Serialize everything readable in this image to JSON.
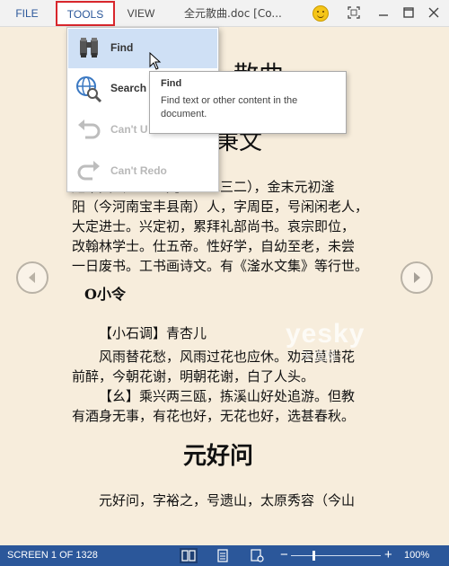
{
  "menu": {
    "file": "FILE",
    "tools": "TOOLS",
    "view": "VIEW",
    "doc_title": "全元散曲.doc [Co..."
  },
  "window_controls": [
    "smiley-icon",
    "fullscreen-icon",
    "minimize-icon",
    "maximize-icon",
    "close-icon"
  ],
  "tools_menu": {
    "items": [
      {
        "label": "Find",
        "icon": "binoculars-icon",
        "enabled": true,
        "highlighted": true
      },
      {
        "label": "Search w",
        "icon": "globe-search-icon",
        "enabled": true,
        "highlighted": false
      },
      {
        "label": "Can't U",
        "icon": "undo-icon",
        "enabled": false,
        "highlighted": false
      },
      {
        "label": "Can't Redo",
        "icon": "redo-icon",
        "enabled": false,
        "highlighted": false
      }
    ]
  },
  "tooltip": {
    "title": "Find",
    "body": "Find text or other content in the document."
  },
  "document": {
    "heading_partial": "散曲",
    "author_heading": "秉文",
    "para1": [
      "赵秉文（一一五九～一二三二），金末元初滏",
      "阳（今河南宝丰县南）人，字周臣，号闲闲老人，",
      "大定进士。兴定初，累拜礼部尚书。哀宗即位，",
      "改翰林学士。仕五帝。性好学，自幼至老，未尝",
      "一日废书。工书画诗文。有《滏水文集》等行世。"
    ],
    "section": "O小令",
    "tune": "【小石调】青杏儿",
    "verse": [
      "风雨替花愁，风雨过花也应休。劝君莫惜花",
      "前醉，今朝花谢，明朝花谢，白了人头。",
      "【幺】乘兴两三瓯，拣溪山好处追游。但教",
      "有酒身无事，有花也好，无花也好，选甚春秋。"
    ],
    "author2": "元好问",
    "para2": "元好问，字裕之，号遗山，太原秀容（今山"
  },
  "watermark": {
    "text": "yesky",
    "sub": "天极网"
  },
  "status": {
    "screen": "SCREEN 1 OF 1328",
    "zoom": "100%",
    "zoom_minus": "−",
    "zoom_plus": "+",
    "zoom_fraction": 0.25
  },
  "colors": {
    "accent": "#2b579a",
    "highlight": "#d8262c",
    "page": "#f7eddc"
  }
}
